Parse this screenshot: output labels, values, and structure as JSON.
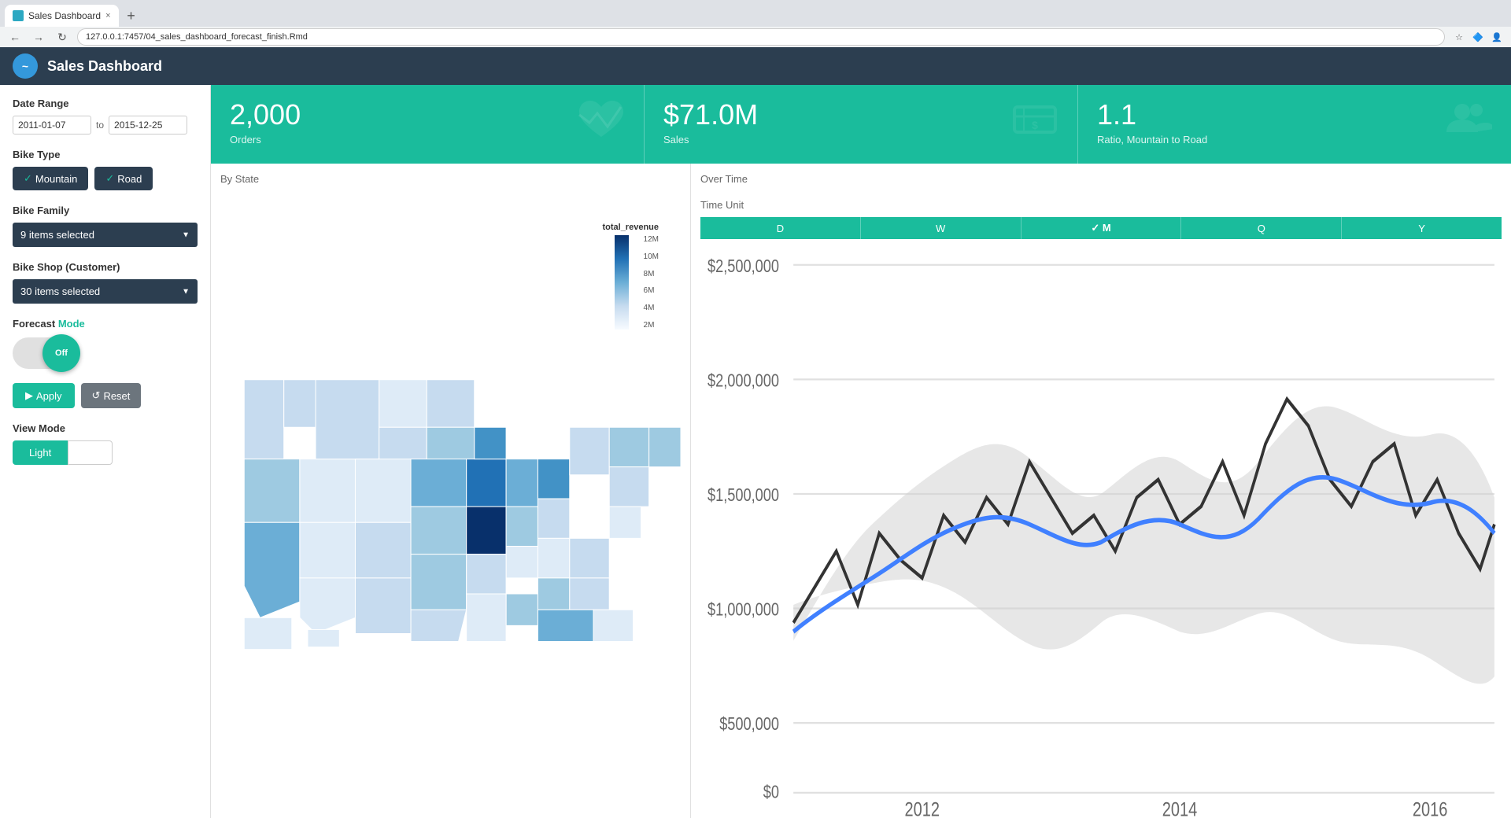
{
  "browser": {
    "tab_title": "Sales Dashboard",
    "tab_close": "×",
    "tab_new": "+",
    "url": "127.0.0.1:7457/04_sales_dashboard_forecast_finish.Rmd",
    "nav_back": "←",
    "nav_forward": "→",
    "nav_refresh": "↻"
  },
  "header": {
    "title": "Sales Dashboard",
    "logo_text": "~"
  },
  "sidebar": {
    "date_range_label": "Date Range",
    "date_from": "2011-01-07",
    "date_to_label": "to",
    "date_to": "2015-12-25",
    "bike_type_label": "Bike Type",
    "bike_type_mountain": "Mountain",
    "bike_type_road": "Road",
    "bike_family_label": "Bike Family",
    "bike_family_value": "9 items selected",
    "bike_shop_label": "Bike Shop (Customer)",
    "bike_shop_value": "30 items selected",
    "forecast_label": "Forecast",
    "forecast_mode_label": "Mode",
    "forecast_toggle_label": "Off",
    "apply_label": "Apply",
    "reset_label": "Reset",
    "view_mode_label": "View Mode",
    "view_light": "Light",
    "view_dark": ""
  },
  "kpis": [
    {
      "value": "2,000",
      "label": "Orders",
      "icon": "❤"
    },
    {
      "value": "$71.0M",
      "label": "Sales",
      "icon": "💲"
    },
    {
      "value": "1.1",
      "label": "Ratio, Mountain to Road",
      "icon": "👤"
    }
  ],
  "map": {
    "title": "By State",
    "legend_title": "total_revenue",
    "legend_max": "12M",
    "legend_10M": "10M",
    "legend_8M": "8M",
    "legend_6M": "6M",
    "legend_4M": "4M",
    "legend_min": "2M"
  },
  "timeseries": {
    "over_time_label": "Over Time",
    "time_unit_label": "Time Unit",
    "time_buttons": [
      "D",
      "W",
      "M",
      "Q",
      "Y"
    ],
    "active_button": "M",
    "y_axis": [
      "$2,500,000",
      "$2,000,000",
      "$1,500,000",
      "$1,000,000",
      "$500,000",
      "$0"
    ],
    "x_axis": [
      "2012",
      "2014",
      "2016"
    ]
  }
}
